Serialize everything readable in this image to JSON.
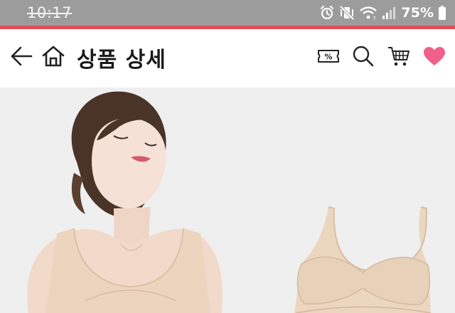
{
  "status_bar": {
    "time": "10:17",
    "battery_percent": "75%",
    "icons": [
      "alarm-icon",
      "vibrate-mute-icon",
      "wifi-icon",
      "signal-icon",
      "battery-icon"
    ]
  },
  "header": {
    "title": "상품 상세",
    "icons": [
      "back-arrow-icon",
      "home-icon",
      "coupon-icon",
      "search-icon",
      "cart-icon",
      "heart-icon"
    ],
    "coupon_symbol": "%"
  },
  "colors": {
    "status_bar_bg": "#9c9c9c",
    "accent": "#e0505a",
    "heart": "#f0608a",
    "image_bg": "#efefef",
    "garment": "#ecd8c2"
  },
  "product_image": {
    "subject": "model wearing nude seamless bra top beside the product"
  }
}
